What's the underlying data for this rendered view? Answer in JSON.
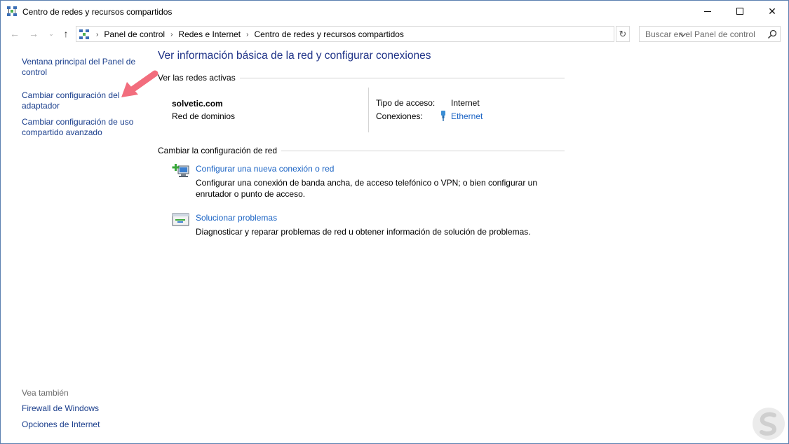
{
  "window": {
    "title": "Centro de redes y recursos compartidos",
    "minimize_icon": "minimize-icon",
    "maximize_icon": "maximize-icon",
    "close_glyph": "✕"
  },
  "nav": {
    "back_glyph": "←",
    "forward_glyph": "→",
    "recent_glyph": "⌄",
    "up_glyph": "↑",
    "breadcrumb": [
      "Panel de control",
      "Redes e Internet",
      "Centro de redes y recursos compartidos"
    ],
    "refresh_glyph": "↻",
    "search_placeholder": "Buscar en el Panel de control"
  },
  "sidebar": {
    "main_link": "Ventana principal del Panel de control",
    "adapter_link": "Cambiar configuración del adaptador",
    "sharing_link": "Cambiar configuración de uso compartido avanzado",
    "see_also": "Vea también",
    "firewall_link": "Firewall de Windows",
    "internet_options_link": "Opciones de Internet"
  },
  "main": {
    "title": "Ver información básica de la red y configurar conexiones",
    "active_networks_heading": "Ver las redes activas",
    "network": {
      "name": "solvetic.com",
      "type": "Red de dominios",
      "access_label": "Tipo de acceso:",
      "access_value": "Internet",
      "connections_label": "Conexiones:",
      "connections_value": "Ethernet"
    },
    "change_heading": "Cambiar la configuración de red",
    "tasks": [
      {
        "link": "Configurar una nueva conexión o red",
        "description": "Configurar una conexión de banda ancha, de acceso telefónico o VPN; o bien configurar un enrutador o punto de acceso."
      },
      {
        "link": "Solucionar problemas",
        "description": "Diagnosticar y reparar problemas de red u obtener información de solución de problemas."
      }
    ]
  },
  "colors": {
    "link": "#1a63c4",
    "nav_link": "#1a3e8c",
    "title": "#1e3287",
    "arrow": "#f26d7d"
  }
}
